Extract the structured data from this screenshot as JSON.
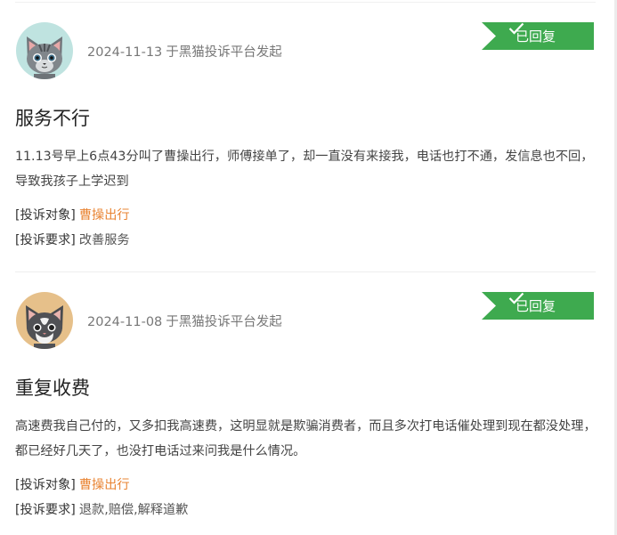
{
  "complaints": [
    {
      "date": "2024-11-13",
      "source": "于黑猫投诉平台发起",
      "status": "已回复",
      "title": "服务不行",
      "description": "11.13号早上6点43分叫了曹操出行，师傅接单了，却一直没有来接我，电话也打不通，发信息也不回，导致我孩子上学迟到",
      "target_label": "[投诉对象]",
      "target": "曹操出行",
      "request_label": "[投诉要求]",
      "request": "改善服务",
      "avatar": "gray-cat-avatar"
    },
    {
      "date": "2024-11-08",
      "source": "于黑猫投诉平台发起",
      "status": "已回复",
      "title": "重复收费",
      "description": "高速费我自己付的，又多扣我高速费，这明显就是欺骗消费者，而且多次打电话催处理到现在都没处理，都已经好几天了，也没打电话过来问我是什么情况。",
      "target_label": "[投诉对象]",
      "target": "曹操出行",
      "request_label": "[投诉要求]",
      "request": "退款,赔偿,解释道歉",
      "avatar": "tan-cat-avatar"
    }
  ],
  "colors": {
    "status_green": "#3eaa4f",
    "link_orange": "#e98433"
  }
}
